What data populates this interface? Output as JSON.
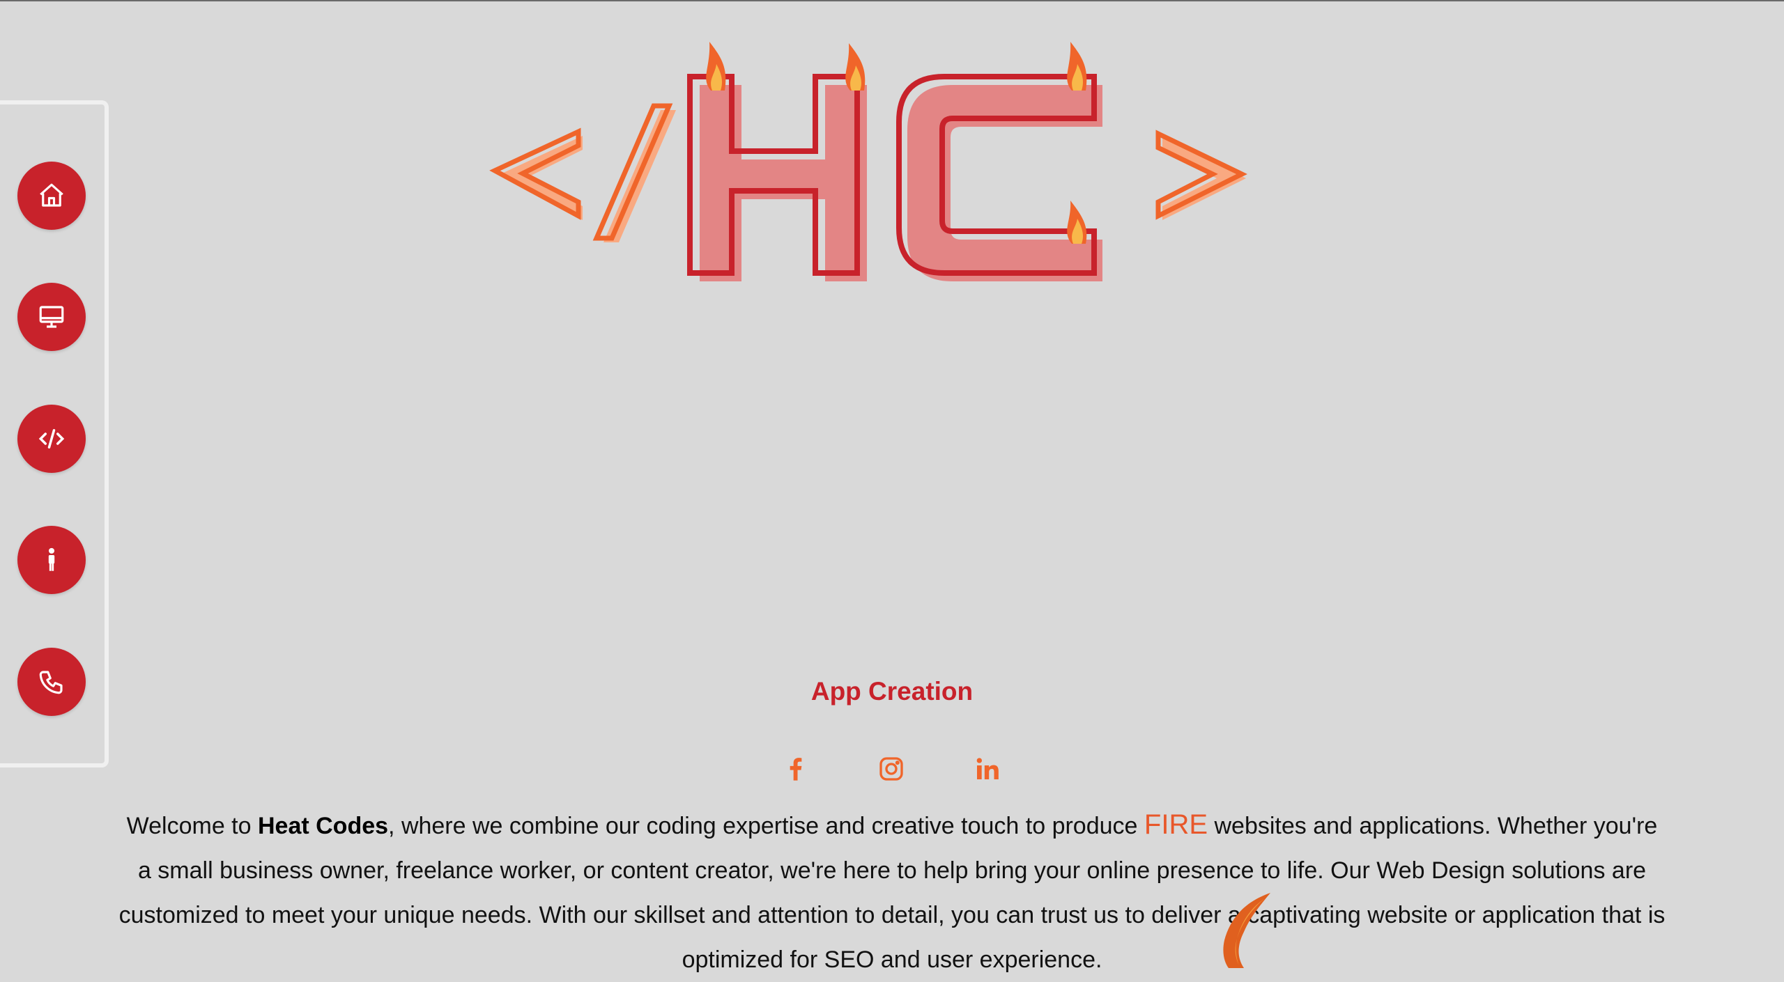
{
  "nav": {
    "items": [
      {
        "name": "home",
        "icon": "home-icon"
      },
      {
        "name": "web-design",
        "icon": "monitor-icon"
      },
      {
        "name": "code",
        "icon": "code-icon"
      },
      {
        "name": "about",
        "icon": "person-icon"
      },
      {
        "name": "contact",
        "icon": "phone-icon"
      }
    ]
  },
  "logo": {
    "text": "</HC>",
    "brand_colors": {
      "red": "#c8222b",
      "orange": "#f0652a",
      "pink": "#e58585"
    }
  },
  "hero": {
    "subtitle": "App Creation",
    "social": [
      {
        "name": "facebook",
        "icon": "facebook-icon"
      },
      {
        "name": "instagram",
        "icon": "instagram-icon"
      },
      {
        "name": "linkedin",
        "icon": "linkedin-icon"
      }
    ],
    "intro": {
      "welcome": "Welcome to ",
      "brand": "Heat Codes",
      "part1": ", where we combine our coding expertise and creative touch to produce ",
      "fire": "FIRE",
      "part2": " websites and applications. Whether you're a small business owner, freelance worker, or content creator, we're here to help bring your online presence to life. Our Web Design solutions are customized to meet your unique needs. With our skillset and attention to detail, you can trust us to deliver a captivating website or application that is optimized for SEO and user experience."
    }
  }
}
